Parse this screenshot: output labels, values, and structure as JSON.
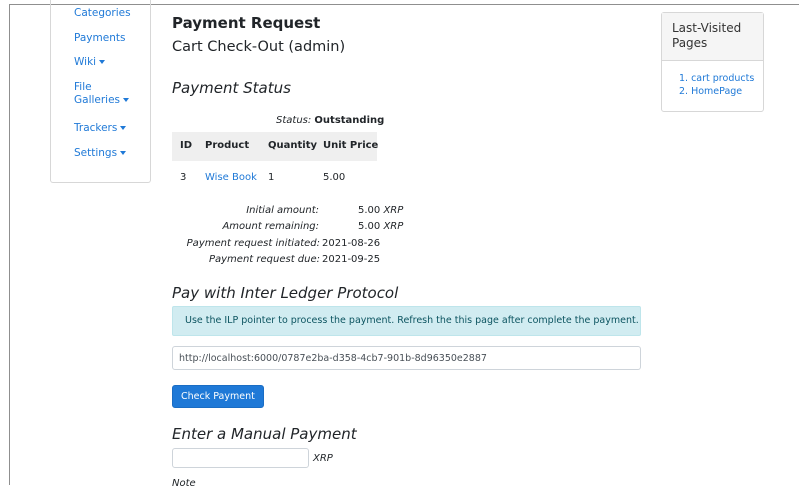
{
  "sidebar": {
    "items": [
      {
        "label": "Categories",
        "dropdown": false
      },
      {
        "label": "Payments",
        "dropdown": false
      },
      {
        "label": "Wiki",
        "dropdown": true
      },
      {
        "label": "File",
        "label2": "Galleries",
        "dropdown": true
      },
      {
        "label": "Trackers",
        "dropdown": true
      },
      {
        "label": "Settings",
        "dropdown": true
      }
    ]
  },
  "main": {
    "title": "Payment Request",
    "subtitle": "Cart Check-Out (admin)",
    "status_heading": "Payment Status",
    "status_label": "Status:",
    "status_value": "Outstanding",
    "table": {
      "headers": [
        "ID",
        "Product",
        "Quantity",
        "Unit Price"
      ],
      "rows": [
        {
          "id": "3",
          "product": "Wise Book",
          "quantity": "1",
          "unit_price": "5.00"
        }
      ]
    },
    "summary": [
      {
        "label": "Initial amount:",
        "value": "5.00",
        "currency": "XRP"
      },
      {
        "label": "Amount remaining:",
        "value": "5.00",
        "currency": "XRP"
      },
      {
        "label": "Payment request initiated:",
        "value": "2021-08-26"
      },
      {
        "label": "Payment request due:",
        "value": "2021-09-25"
      }
    ],
    "ilp_heading": "Pay with Inter Ledger Protocol",
    "ilp_alert": "Use the ILP pointer to process the payment. Refresh the this page after complete the payment.",
    "ilp_pointer": "http://localhost:6000/0787e2ba-d358-4cb7-901b-8d96350e2887",
    "check_button": "Check Payment",
    "manual_heading": "Enter a Manual Payment",
    "manual_amount": "",
    "manual_currency": "XRP",
    "note_label": "Note"
  },
  "recent": {
    "title": "Last-Visited Pages",
    "items": [
      "1. cart products",
      "2. HomePage"
    ]
  },
  "colors": {
    "link": "#1f79d7",
    "button": "#1f79d7",
    "alert_bg": "#d1ecf1",
    "alert_text": "#0c5460"
  }
}
